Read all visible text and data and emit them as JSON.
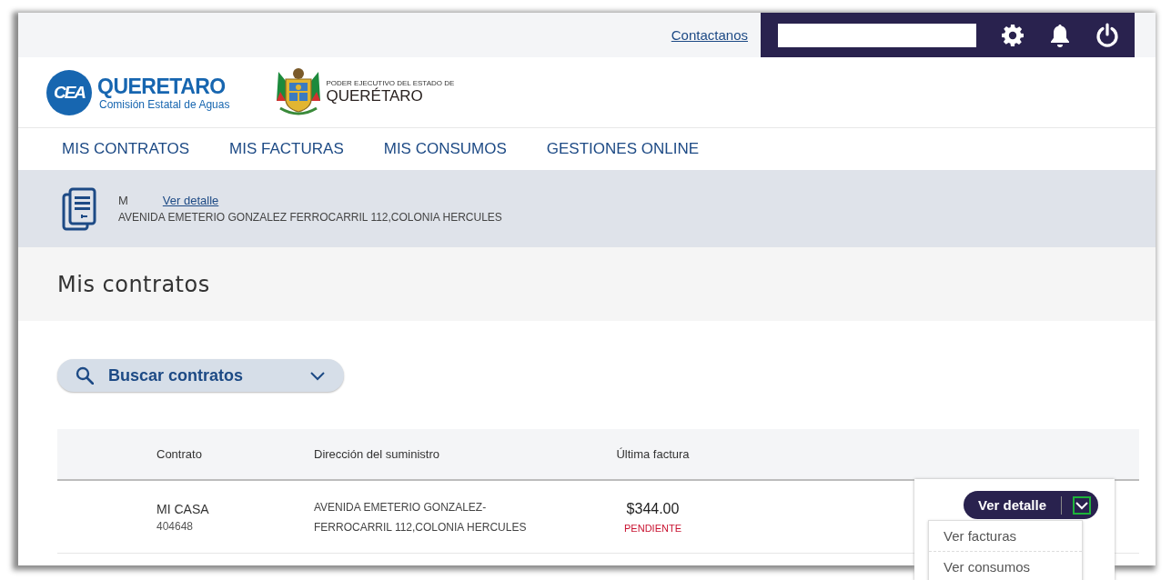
{
  "top_bar": {
    "contact_link": "Contactanos"
  },
  "logos": {
    "cea": {
      "mark": "CEA",
      "name": "QUERETARO",
      "subtitle": "Comisión Estatal de Aguas"
    },
    "state": {
      "caption": "PODER EJECUTIVO DEL ESTADO DE",
      "name": "QUERÉTARO"
    }
  },
  "nav": [
    {
      "label": "MIS CONTRATOS"
    },
    {
      "label": "MIS FACTURAS"
    },
    {
      "label": "MIS CONSUMOS"
    },
    {
      "label": "GESTIONES ONLINE"
    }
  ],
  "contract_banner": {
    "name": "M",
    "link": "Ver detalle",
    "address": "AVENIDA EMETERIO GONZALEZ FERROCARRIL 112,COLONIA HERCULES"
  },
  "page_title": "Mis contratos",
  "search": {
    "label": "Buscar contratos",
    "expanded": false
  },
  "table": {
    "columns": [
      "Contrato",
      "Dirección del suministro",
      "Última factura"
    ],
    "rows": [
      {
        "name": "MI CASA",
        "number": "404648",
        "address": "AVENIDA EMETERIO GONZALEZ-FERROCARRIL 112,COLONIA HERCULES",
        "amount": "$344.00",
        "status": "PENDIENTE",
        "action": "Ver detalle",
        "menu_open": true,
        "menu": [
          "Ver facturas",
          "Ver consumos"
        ]
      }
    ]
  }
}
